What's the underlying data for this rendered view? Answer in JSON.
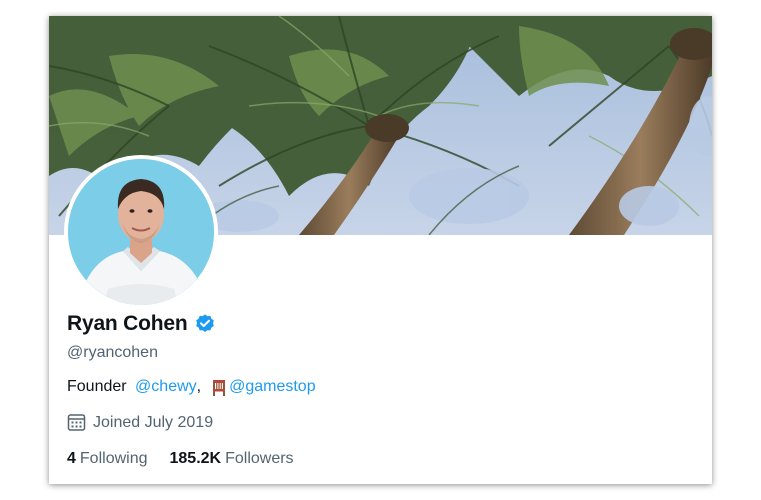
{
  "profile": {
    "name": "Ryan Cohen",
    "handle": "@ryancohen",
    "bio": {
      "prefix": "Founder ",
      "mention1": "@chewy",
      "separator": ",",
      "mention2": "@gamestop",
      "emoji_icon": "chair-icon"
    },
    "joined": "Joined July 2019",
    "following_count": "4",
    "following_label": "Following",
    "followers_count": "185.2K",
    "followers_label": "Followers",
    "verified_icon": "verified-badge-icon"
  },
  "colors": {
    "link": "#1d9bf0",
    "secondary_text": "#536471",
    "primary_text": "#0f1419",
    "verified": "#1d9bf0"
  }
}
